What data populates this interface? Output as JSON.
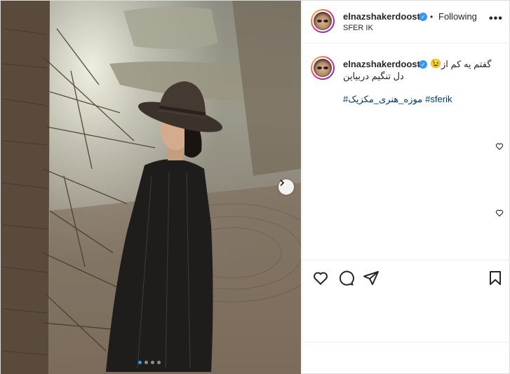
{
  "post": {
    "username": "elnazshakerdoost",
    "follow_label": "Following",
    "bullet": "•",
    "location": "SFER IK",
    "more_label": "•••",
    "caption": {
      "line1": "گفتم یه کم از",
      "line2": "دل تنگیم دربیاین",
      "emoji": "😉"
    },
    "hashtags": [
      "#sferik",
      "#موزه_هنری_مکزیک"
    ],
    "carousel": {
      "total": 4,
      "active": 1
    }
  },
  "colors": {
    "verified": "#3897f0",
    "hashtag": "#00376b",
    "carousel_active": "#3797f0"
  },
  "icons": [
    "verified-badge-icon",
    "more-options-icon",
    "next-arrow-icon",
    "like-icon",
    "comment-icon",
    "share-icon",
    "save-icon",
    "small-heart-icon"
  ]
}
